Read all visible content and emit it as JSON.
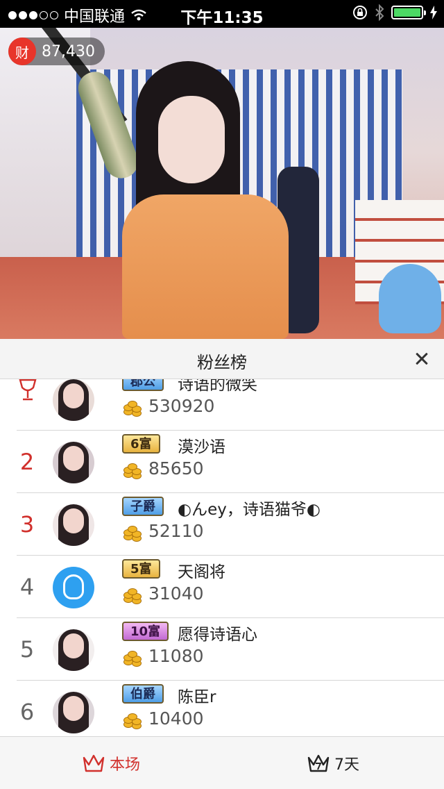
{
  "status_bar": {
    "carrier": "中国联通",
    "time": "下午11:35",
    "signal_bars": 3,
    "battery_level": 1.0
  },
  "stream": {
    "wealth_icon": "财",
    "wealth_value": "87,430"
  },
  "panel": {
    "title": "粉丝榜",
    "close_icon": "close-icon"
  },
  "ranking": [
    {
      "rank": "",
      "rank_icon": "trophy-icon",
      "badge": "郡公",
      "badge_style": "blue",
      "name": "诗语的微笑",
      "score": "530920"
    },
    {
      "rank": "2",
      "badge": "6富",
      "badge_style": "gold",
      "name": "漠沙语",
      "score": "85650"
    },
    {
      "rank": "3",
      "badge": "子爵",
      "badge_style": "blue",
      "name": "◐んey，诗语猫爷◐",
      "score": "52110"
    },
    {
      "rank": "4",
      "badge": "5富",
      "badge_style": "gold",
      "name": "天阁将",
      "score": "31040"
    },
    {
      "rank": "5",
      "badge": "10富",
      "badge_style": "pink",
      "name": "愿得诗语心",
      "score": "11080"
    },
    {
      "rank": "6",
      "badge": "伯爵",
      "badge_style": "blue",
      "name": "陈臣r",
      "score": "10400"
    }
  ],
  "tabs": [
    {
      "label": "本场",
      "icon": "crown-icon",
      "active": true
    },
    {
      "label": "7天",
      "icon": "crown-7-icon",
      "active": false
    }
  ],
  "colors": {
    "accent_red": "#d1302c",
    "status_battery": "#4cd964"
  }
}
